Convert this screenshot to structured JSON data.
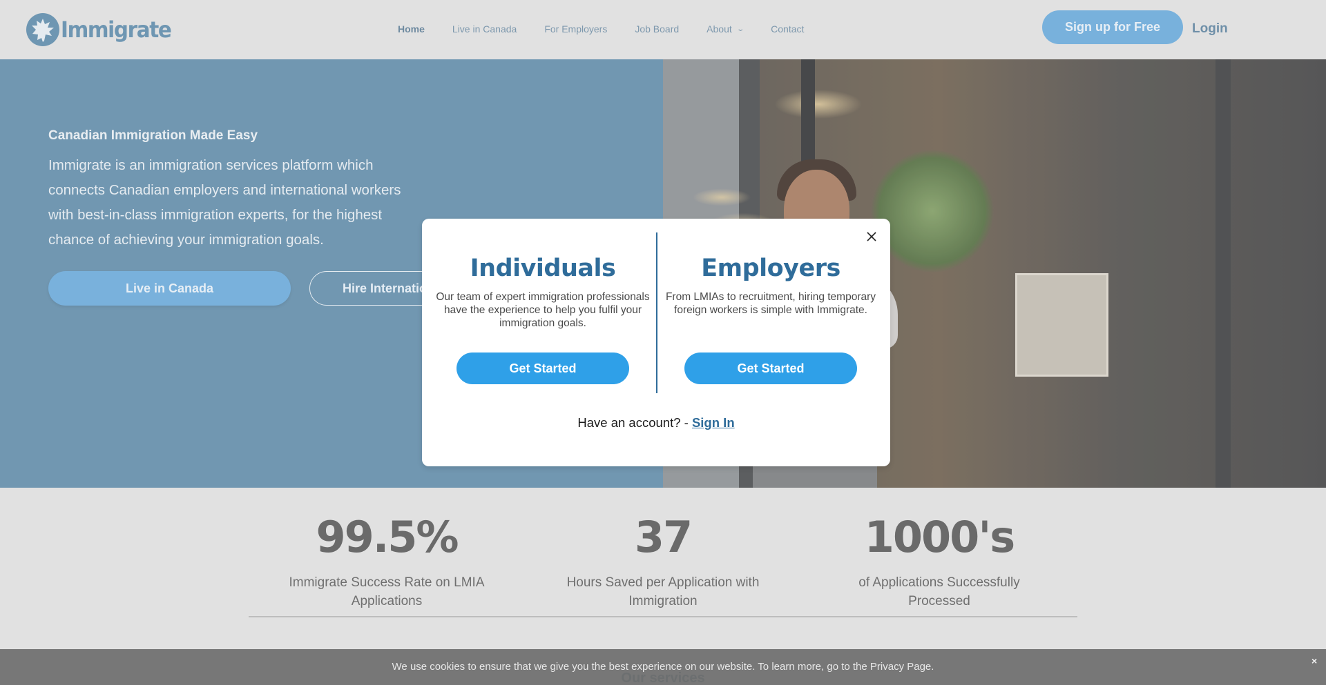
{
  "header": {
    "logo_text": "Immigrate",
    "nav": [
      {
        "label": "Home",
        "active": true
      },
      {
        "label": "Live in Canada"
      },
      {
        "label": "For Employers"
      },
      {
        "label": "Job Board"
      },
      {
        "label": "About",
        "has_dropdown": true
      },
      {
        "label": "Contact"
      }
    ],
    "signup_label": "Sign up for Free",
    "login_label": "Login"
  },
  "hero": {
    "tagline": "Canadian Immigration Made Easy",
    "description": "Immigrate is an immigration services platform which connects Canadian employers and international workers with best-in-class immigration experts, for the highest chance of achieving your immigration goals.",
    "primary_button": "Live in Canada",
    "secondary_button": "Hire International"
  },
  "stats": [
    {
      "value": "99.5%",
      "label": "Immigrate Success Rate on LMIA Applications"
    },
    {
      "value": "37",
      "label": "Hours Saved per Application with Immigration"
    },
    {
      "value": "1000's",
      "label": "of Applications Successfully Processed"
    }
  ],
  "services_heading": "Our services",
  "modal": {
    "individuals": {
      "title": "Individuals",
      "text": "Our team of expert immigration professionals have the experience to help you fulfil your immigration goals.",
      "button": "Get Started"
    },
    "employers": {
      "title": "Employers",
      "text": "From LMIAs to recruitment, hiring temporary foreign workers is simple with Immigrate.",
      "button": "Get Started"
    },
    "footer_text": "Have an account? - ",
    "signin_label": "Sign In"
  },
  "cookie": {
    "text": "We use cookies to ensure that we give you the best experience on our website. To learn more, go to the Privacy Page.",
    "close_glyph": "×"
  },
  "colors": {
    "brand": "#2f6c9a",
    "button_blue": "#2fa0e8",
    "hero_bg": "#7197b1"
  }
}
